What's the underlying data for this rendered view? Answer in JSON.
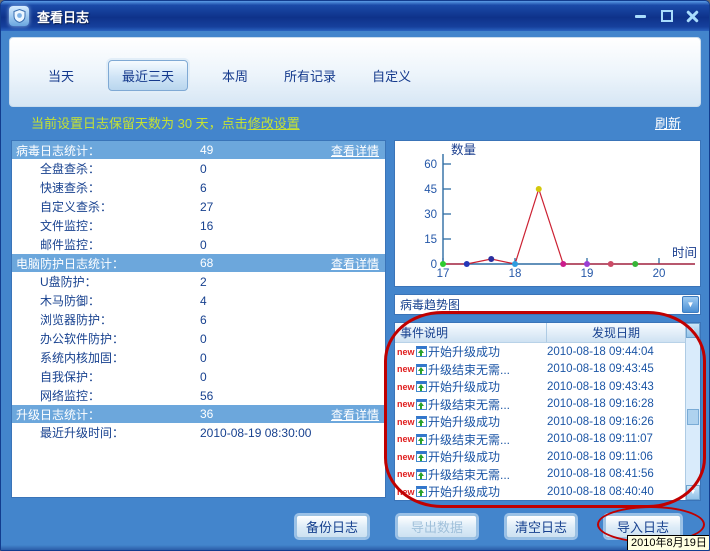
{
  "window": {
    "title": "查看日志"
  },
  "tabs": {
    "items": [
      {
        "label": "当天",
        "selected": false
      },
      {
        "label": "最近三天",
        "selected": true
      },
      {
        "label": "本周",
        "selected": false
      },
      {
        "label": "所有记录",
        "selected": false
      },
      {
        "label": "自定义",
        "selected": false
      }
    ]
  },
  "info_bar": {
    "text_before": "当前设置日志保留天数为 30 天，点击",
    "settings_link": "修改设置",
    "refresh_link": "刷新"
  },
  "stats": {
    "sections": [
      {
        "header": "病毒日志统计：",
        "value": 49,
        "link": "查看详情",
        "items": [
          {
            "label": "全盘查杀：",
            "value": 0
          },
          {
            "label": "快速查杀：",
            "value": 6
          },
          {
            "label": "自定义查杀：",
            "value": 27
          },
          {
            "label": "文件监控：",
            "value": 16
          },
          {
            "label": "邮件监控：",
            "value": 0
          }
        ]
      },
      {
        "header": "电脑防护日志统计：",
        "value": 68,
        "link": "查看详情",
        "items": [
          {
            "label": "U盘防护：",
            "value": 2
          },
          {
            "label": "木马防御：",
            "value": 4
          },
          {
            "label": "浏览器防护：",
            "value": 6
          },
          {
            "label": "办公软件防护：",
            "value": 0
          },
          {
            "label": "系统内核加固：",
            "value": 0
          },
          {
            "label": "自我保护：",
            "value": 0
          },
          {
            "label": "网络监控：",
            "value": 56
          }
        ]
      },
      {
        "header": "升级日志统计：",
        "value": 36,
        "link": "查看详情",
        "items": [
          {
            "label": "最近升级时间：",
            "value": "2010-08-19 08:30:00"
          }
        ]
      }
    ]
  },
  "trend": {
    "dropdown_value": "病毒趋势图"
  },
  "table": {
    "columns": [
      "事件说明",
      "发现日期"
    ],
    "rows": [
      {
        "badge": "new",
        "event": "开始升级成功",
        "date": "2010-08-18 09:44:04"
      },
      {
        "badge": "new",
        "event": "升级结束无需...",
        "date": "2010-08-18 09:43:45"
      },
      {
        "badge": "new",
        "event": "开始升级成功",
        "date": "2010-08-18 09:43:43"
      },
      {
        "badge": "new",
        "event": "升级结束无需...",
        "date": "2010-08-18 09:16:28"
      },
      {
        "badge": "new",
        "event": "开始升级成功",
        "date": "2010-08-18 09:16:26"
      },
      {
        "badge": "new",
        "event": "升级结束无需...",
        "date": "2010-08-18 09:11:07"
      },
      {
        "badge": "new",
        "event": "开始升级成功",
        "date": "2010-08-18 09:11:06"
      },
      {
        "badge": "new",
        "event": "升级结束无需...",
        "date": "2010-08-18 08:41:56"
      },
      {
        "badge": "new",
        "event": "开始升级成功",
        "date": "2010-08-18 08:40:40"
      }
    ]
  },
  "buttons": [
    {
      "label": "备份日志",
      "name": "backup-log-button",
      "enabled": true
    },
    {
      "label": "导出数据",
      "name": "export-data-button",
      "enabled": false
    },
    {
      "label": "清空日志",
      "name": "clear-log-button",
      "enabled": true
    },
    {
      "label": "导入日志",
      "name": "import-log-button",
      "enabled": true
    }
  ],
  "tooltip": {
    "text": "2010年8月19日"
  },
  "icons": {
    "app": "shield",
    "minimize": "bar",
    "maximize": "square",
    "close": "x-cross",
    "dropdown_arrow": "▼",
    "triangle_up": "▲",
    "triangle_down": "▼",
    "row_icon": "window-green-up-arrow",
    "new_badge": "new"
  },
  "colors": {
    "window_bg": "#4385cc",
    "titlebar_dark": "#0e328a",
    "section_header_bg": "#6ca7dc",
    "navy_text": "#17418f",
    "table_text": "#1b55a5",
    "info_text": "#c6e232",
    "new_badge_red": "#e02020",
    "annotation_red": "#c00000",
    "tooltip_bg": "#ffffe1",
    "chart_line": "#cc2233",
    "chart_axis": "#2e6da4"
  },
  "chart_data": {
    "type": "line",
    "title": "病毒趋势图",
    "xlabel": "时间",
    "ylabel": "数量",
    "xticks": [
      17,
      18,
      19,
      20
    ],
    "yticks": [
      0,
      15,
      30,
      45,
      60
    ],
    "xlim": [
      17,
      20.4
    ],
    "ylim": [
      0,
      60
    ],
    "grid": false,
    "legend": "none",
    "line_extends_to_right_edge": true,
    "series": [
      {
        "name": "病毒趋势",
        "color": "#cc2233",
        "points": [
          {
            "x": 17.0,
            "y": 0,
            "dot_color": "#2ecc2e"
          },
          {
            "x": 17.33,
            "y": 0,
            "dot_color": "#2536b8"
          },
          {
            "x": 17.67,
            "y": 3,
            "dot_color": "#2b2f9e"
          },
          {
            "x": 18.0,
            "y": 0,
            "dot_color": "#2f9de0"
          },
          {
            "x": 18.33,
            "y": 45,
            "dot_color": "#d4c80c"
          },
          {
            "x": 18.67,
            "y": 0,
            "dot_color": "#cc1c8c"
          },
          {
            "x": 19.0,
            "y": 0,
            "dot_color": "#9a3fd4"
          },
          {
            "x": 19.33,
            "y": 0,
            "dot_color": "#cc4a66"
          },
          {
            "x": 19.67,
            "y": 0,
            "dot_color": "#37b437"
          }
        ]
      }
    ]
  }
}
